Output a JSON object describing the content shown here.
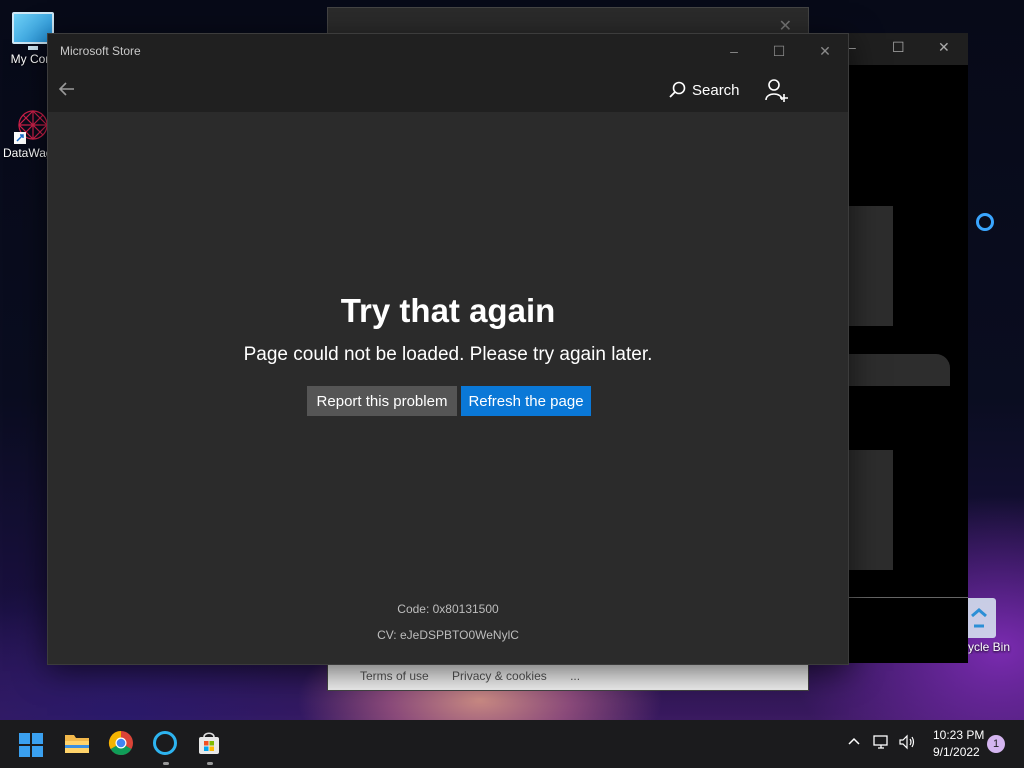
{
  "desktop": {
    "icons": [
      {
        "label": "My Com",
        "icon": "monitor-icon"
      },
      {
        "label": "DataWag",
        "icon": "datawag-icon"
      },
      {
        "label": "ycle Bin",
        "icon": "recycle-bin-icon"
      }
    ]
  },
  "background_window": {
    "footer_links": [
      "Terms of use",
      "Privacy & cookies",
      "..."
    ]
  },
  "store_window": {
    "title": "Microsoft Store",
    "controls": {
      "minimize": "minimize-icon",
      "maximize": "maximize-icon",
      "close": "close-icon"
    },
    "nav": {
      "back_icon": "back-arrow-icon",
      "search_label": "Search",
      "account_icon": "add-account-icon"
    },
    "error": {
      "title": "Try that again",
      "message": "Page could not be loaded. Please try again later.",
      "report_button": "Report this problem",
      "refresh_button": "Refresh the page",
      "code": "Code: 0x80131500",
      "cv": "CV: eJeDSPBTO0WeNylC"
    },
    "colors": {
      "accent": "#0a78d7",
      "background": "#2b2b2b",
      "titlebar": "#202020"
    }
  },
  "taskbar": {
    "apps": [
      "start-icon",
      "file-explorer-icon",
      "chrome-icon",
      "cortana-icon",
      "store-icon"
    ],
    "tray": {
      "time": "10:23 PM",
      "date": "9/1/2022",
      "notification_count": "1"
    }
  }
}
